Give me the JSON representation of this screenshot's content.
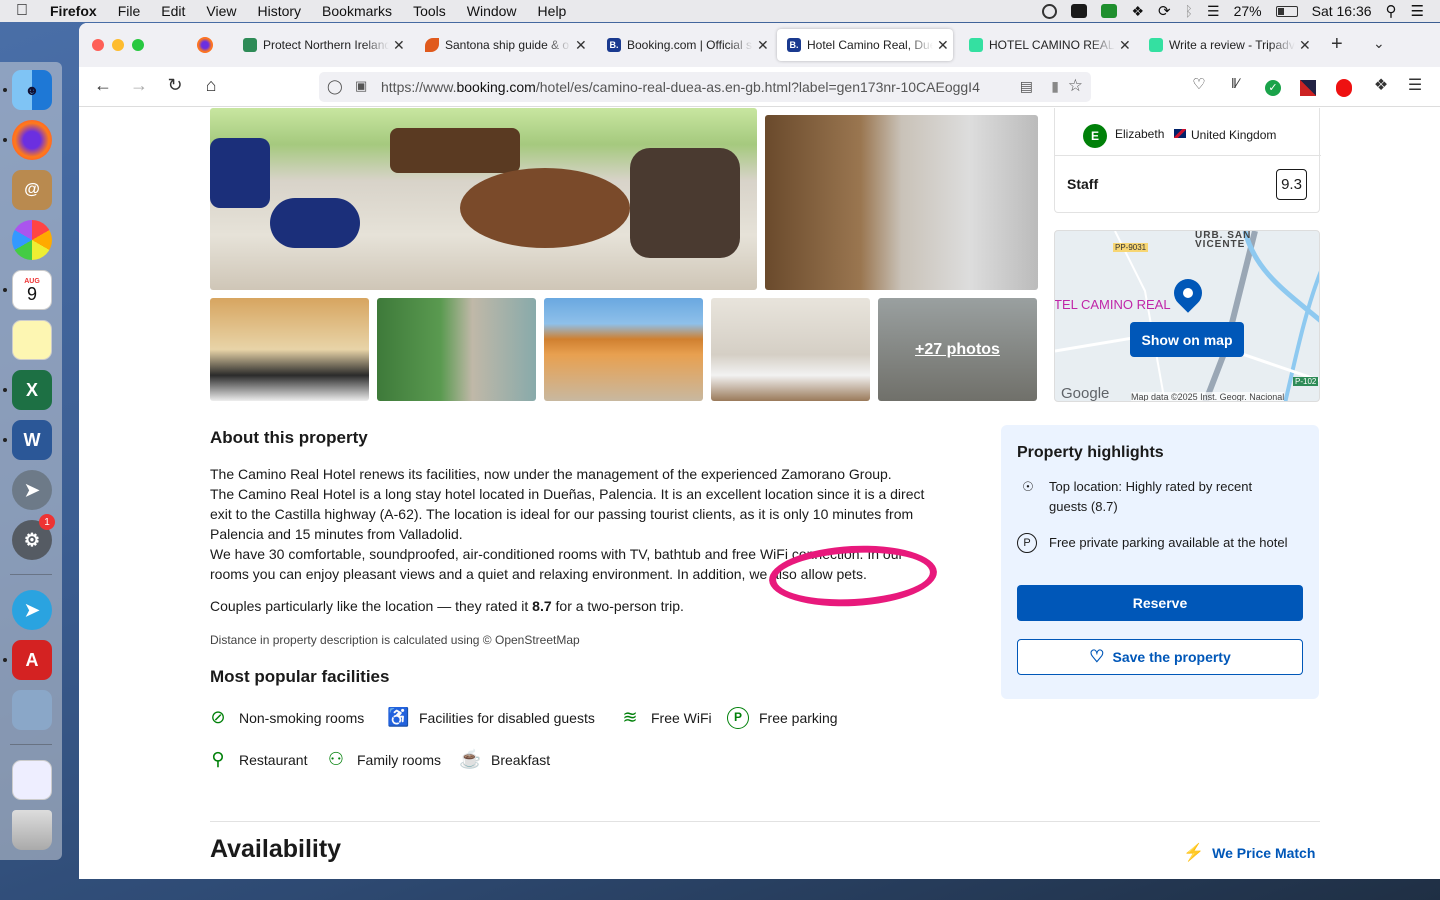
{
  "menubar": {
    "app": "Firefox",
    "menus": [
      "File",
      "Edit",
      "View",
      "History",
      "Bookmarks",
      "Tools",
      "Window",
      "Help"
    ],
    "battery": "27%",
    "clock": "Sat 16:36"
  },
  "dock": {
    "calendar_month": "AUG",
    "calendar_day": "9",
    "badge": "1"
  },
  "tabs": [
    {
      "title": "Protect Northern Ireland",
      "favicon_color": "#2e8b57"
    },
    {
      "title": "Santona ship guide & o",
      "favicon_color": "#e05a1c"
    },
    {
      "title": "Booking.com | Official s",
      "favicon_color": "#1a3a8f",
      "favicon_text": "B."
    },
    {
      "title": "Hotel Camino Real, Due",
      "favicon_color": "#1a3a8f",
      "favicon_text": "B."
    },
    {
      "title": "HOTEL CAMINO REAL - ",
      "favicon_color": "#34e0a1"
    },
    {
      "title": "Write a review - Tripadv",
      "favicon_color": "#34e0a1"
    }
  ],
  "url": {
    "prefix": "https://www.",
    "domain": "booking.com",
    "path": "/hotel/es/camino-real-duea-as.en-gb.html?label=gen173nr-10CAEoggI4"
  },
  "gallery": {
    "more_photos": "+27 photos"
  },
  "review": {
    "initial": "E",
    "name": "Elizabeth",
    "country": "United Kingdom",
    "category": "Staff",
    "score": "9.3"
  },
  "map": {
    "place_label": "TEL CAMINO REAL",
    "town_line1": "URB. SAN",
    "town_line2": "VICENTE",
    "road1": "PP-9031",
    "road2": "P-102",
    "button": "Show on map",
    "google": "Google",
    "credit": "Map data ©2025 Inst. Geogr. Nacional"
  },
  "about": {
    "heading": "About this property",
    "paragraphs": [
      "The Camino Real Hotel renews its facilities, now under the management of the experienced Zamorano Group.",
      "The Camino Real Hotel is a long stay hotel located in Dueñas, Palencia. It is an excellent location since it is a direct exit to the Castilla highway (A-62). The location is ideal for our passing tourist clients, as it is only 10 minutes from Palencia and 15 minutes from Valladolid.",
      "We have 30 comfortable, soundproofed, air-conditioned rooms with TV, bathtub and free WiFi connection. In our rooms you can enjoy pleasant views and a quiet and relaxing environment. In addition, we also allow pets."
    ],
    "couples_prefix": "Couples particularly like the location — they rated it ",
    "couples_score": "8.7",
    "couples_suffix": " for a two-person trip.",
    "distance_note": "Distance in property description is calculated using © OpenStreetMap"
  },
  "facilities": {
    "heading": "Most popular facilities",
    "items": [
      "Non-smoking rooms",
      "Facilities for disabled guests",
      "Free WiFi",
      "Free parking",
      "Restaurant",
      "Family rooms",
      "Breakfast"
    ]
  },
  "highlights": {
    "heading": "Property highlights",
    "location": "Top location: Highly rated by recent guests (8.7)",
    "parking": "Free private parking available at the hotel",
    "reserve": "Reserve",
    "save": "Save the property"
  },
  "availability": {
    "heading": "Availability",
    "price_match": "We Price Match"
  },
  "colors": {
    "brand_blue": "#0057b8",
    "facility_green": "#008009",
    "annotation_pink": "#e8197c"
  }
}
